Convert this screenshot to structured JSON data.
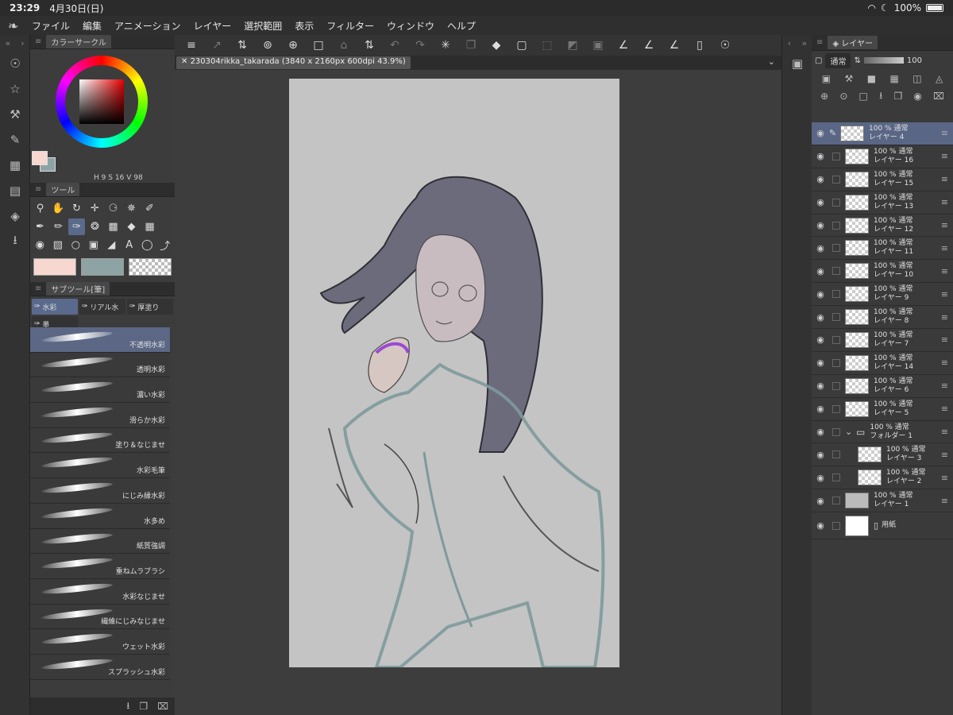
{
  "status": {
    "time": "23:29",
    "date": "4月30日(日)",
    "battery": "100%"
  },
  "menu": [
    "ファイル",
    "編集",
    "アニメーション",
    "レイヤー",
    "選択範囲",
    "表示",
    "フィルター",
    "ウィンドウ",
    "ヘルプ"
  ],
  "color_panel": {
    "title": "カラーサークル",
    "h_label": "H",
    "h": "9",
    "s_label": "S",
    "s": "16",
    "v_label": "V",
    "v": "98",
    "main_color": "#f6d8d0",
    "sub_color": "#8ea4a4"
  },
  "tool_panel": {
    "title": "ツール"
  },
  "subtool_panel": {
    "title": "サブツール[筆]",
    "tabs": [
      "水彩",
      "リアル水",
      "厚塗り",
      "墨"
    ],
    "brushes": [
      "不透明水彩",
      "透明水彩",
      "濃い水彩",
      "滑らか水彩",
      "塗り＆なじませ",
      "水彩毛筆",
      "にじみ縁水彩",
      "水多め",
      "紙質強調",
      "重ねムラブラシ",
      "水彩なじませ",
      "繊維にじみなじませ",
      "ウェット水彩",
      "スプラッシュ水彩"
    ]
  },
  "canvas": {
    "tab_title": "230304rikka_takarada (3840 x 2160px 600dpi 43.9%)"
  },
  "layer_panel": {
    "title": "レイヤー",
    "blend_mode": "通常",
    "opacity": "100",
    "layers": [
      {
        "info": "100 % 通常",
        "name": "レイヤー 4"
      },
      {
        "info": "100 % 通常",
        "name": "レイヤー 16"
      },
      {
        "info": "100 % 通常",
        "name": "レイヤー 15"
      },
      {
        "info": "100 % 通常",
        "name": "レイヤー 13"
      },
      {
        "info": "100 % 通常",
        "name": "レイヤー 12"
      },
      {
        "info": "100 % 通常",
        "name": "レイヤー 11"
      },
      {
        "info": "100 % 通常",
        "name": "レイヤー 10"
      },
      {
        "info": "100 % 通常",
        "name": "レイヤー 9"
      },
      {
        "info": "100 % 通常",
        "name": "レイヤー 8"
      },
      {
        "info": "100 % 通常",
        "name": "レイヤー 7"
      },
      {
        "info": "100 % 通常",
        "name": "レイヤー 14"
      },
      {
        "info": "100 % 通常",
        "name": "レイヤー 6"
      },
      {
        "info": "100 % 通常",
        "name": "レイヤー 5"
      },
      {
        "info": "100 % 通常",
        "name": "フォルダー 1"
      },
      {
        "info": "100 % 通常",
        "name": "レイヤー 3"
      },
      {
        "info": "100 % 通常",
        "name": "レイヤー 2"
      },
      {
        "info": "100 % 通常",
        "name": "レイヤー 1"
      },
      {
        "info": "",
        "name": "用紙"
      }
    ]
  }
}
